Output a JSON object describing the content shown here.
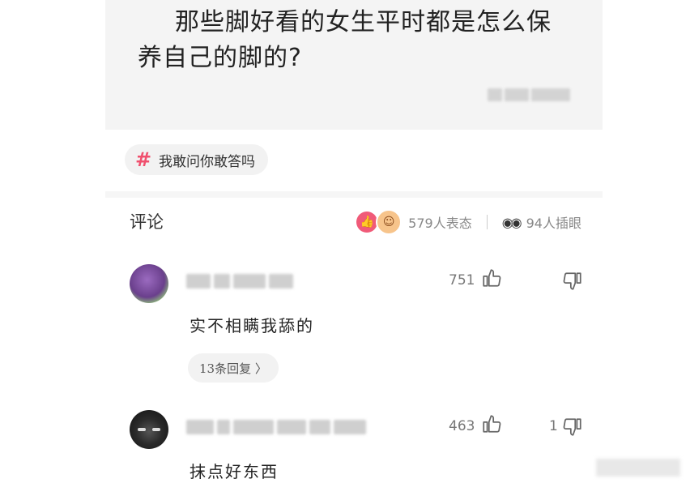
{
  "question": {
    "title": "那些脚好看的女生平时都是怎么保养自己的脚的?"
  },
  "topic": {
    "hash_symbol": "#",
    "label": "我敢问你敢答吗"
  },
  "comments_header": {
    "title": "评论",
    "reactions_text": "579人表态",
    "watching_text": "94人插眼"
  },
  "comments": [
    {
      "likes": "751",
      "dislikes": "",
      "text": "实不相瞒我舔的",
      "replies_label": "13条回复 〉"
    },
    {
      "likes": "463",
      "dislikes": "1",
      "text": "抹点好东西"
    }
  ],
  "colors": {
    "accent": "#f0506e",
    "question_bg": "#f4f4f4",
    "chip_bg": "#f2f2f2"
  }
}
